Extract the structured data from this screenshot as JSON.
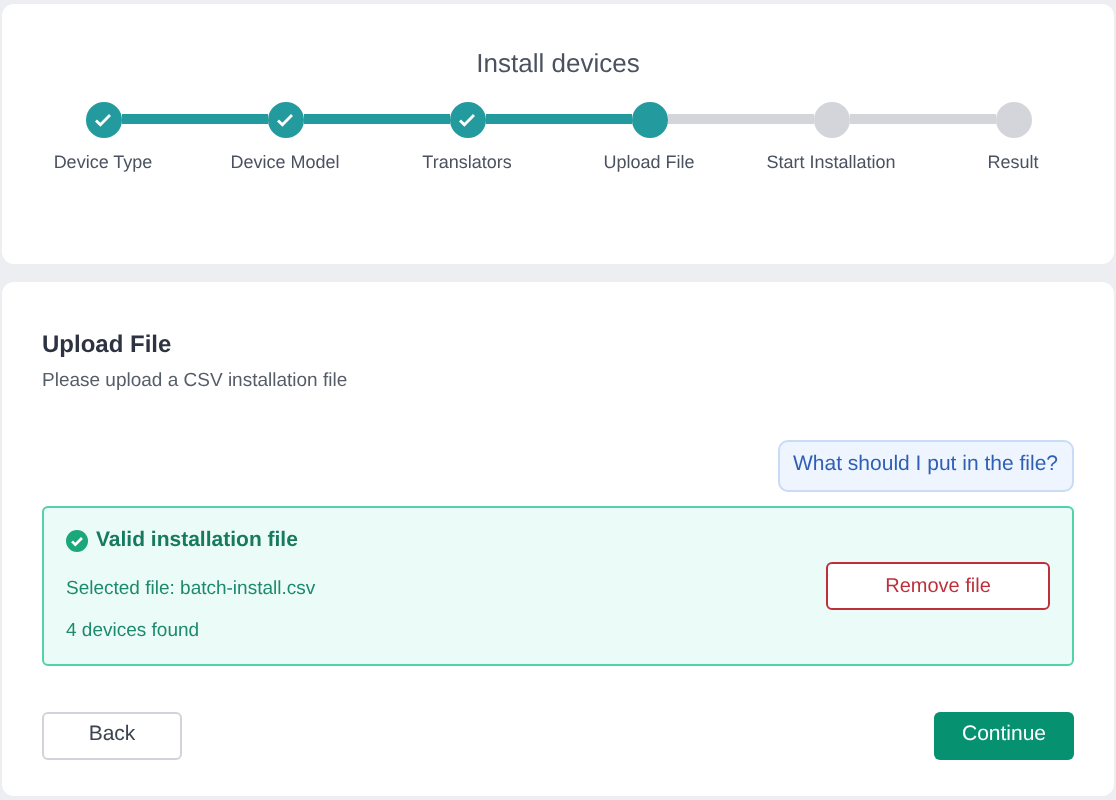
{
  "title": "Install devices",
  "steps": [
    {
      "label": "Device Type",
      "completed": true
    },
    {
      "label": "Device Model",
      "completed": true
    },
    {
      "label": "Translators",
      "completed": true
    },
    {
      "label": "Upload File",
      "completed": false
    },
    {
      "label": "Start Installation",
      "completed": false
    },
    {
      "label": "Result",
      "completed": false
    }
  ],
  "section": {
    "title": "Upload File",
    "subtitle": "Please upload a CSV installation file"
  },
  "help_button": "What should I put in the file?",
  "file_alert": {
    "title": "Valid installation file",
    "lines": [
      "Selected file: batch-install.csv",
      "4 devices found"
    ],
    "remove_button": "Remove file"
  },
  "buttons": {
    "back": "Back",
    "continue": "Continue"
  }
}
